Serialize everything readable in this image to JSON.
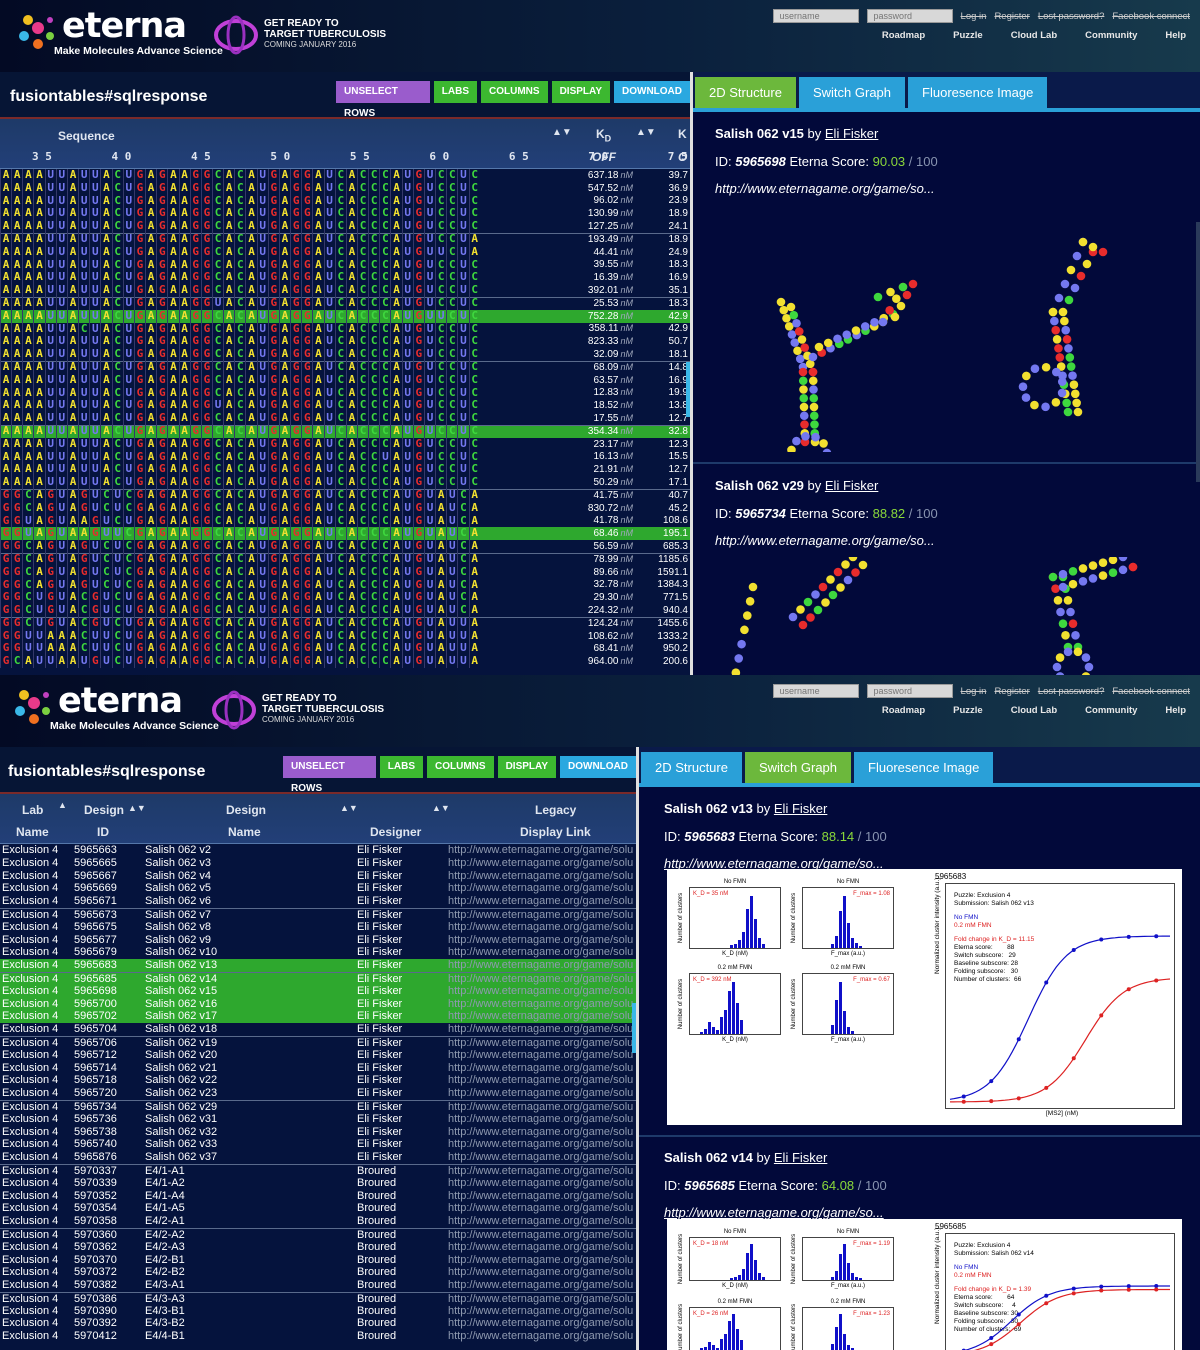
{
  "header": {
    "logo_text": "eterna",
    "tagline": "Make Molecules  Advance Science",
    "promo_line1": "GET READY TO",
    "promo_line2": "TARGET TUBERCULOSIS",
    "promo_line3": "COMING JANUARY 2016",
    "username_placeholder": "username",
    "password_placeholder": "password",
    "links": [
      "Log in",
      "Register",
      "Lost password?",
      "Facebook connect"
    ],
    "nav": [
      "Roadmap",
      "Puzzle",
      "Cloud Lab",
      "Community",
      "Help"
    ]
  },
  "toolbar": {
    "title": "fusiontables#sqlresponse",
    "buttons": [
      "UNSELECT ROWS",
      "LABS",
      "COLUMNS",
      "DISPLAY",
      "DOWNLOAD"
    ]
  },
  "tabs": [
    "2D Structure",
    "Switch Graph",
    "Fluoresence Image"
  ],
  "top_table": {
    "col_sequence": "Sequence",
    "col_kd": "K",
    "col_kd_sub": "D",
    "col_k_cut": "K",
    "ruler": "3 5         4 0         4 5         5 0         5 5         6 0         6 5         7 0         7 5",
    "off_label": "OFF",
    "on_label_cut": "O",
    "unit": "nM",
    "rows": [
      {
        "seq": "AAAAUUAUUACUGAGAAGGCACAUGAGGAUCACCCAUGUCCUC",
        "off": "637.18",
        "on": "39.7"
      },
      {
        "seq": "AAAAUUAUUACUGAGAAGGCACAUGAGGAUCACCCAUGUCCUC",
        "off": "547.52",
        "on": "36.9"
      },
      {
        "seq": "AAAAUUAUUACUGAGAAGGCACAUGAGGAUCACCCAUGUCCUC",
        "off": "96.02",
        "on": "23.9"
      },
      {
        "seq": "AAAAUUAUUACUGAGAAGGCACAUGAGGAUCACCCAUGUCCUC",
        "off": "130.99",
        "on": "18.9"
      },
      {
        "seq": "AAAAUUAUUACUGAGAAGGCACAUGAGGAUCACCCAUGUCCUC",
        "off": "127.25",
        "on": "24.1"
      },
      {
        "seq": "AAAAUUAUUACUGAGAAGGCACAUGAGGAUCACCCAUGUCCUA",
        "off": "193.49",
        "on": "18.9",
        "sep": true
      },
      {
        "seq": "AAAAUUAUUACUGAGAAGGCACAUGAGGAUCACCCAUGUUCUA",
        "off": "44.41",
        "on": "24.9"
      },
      {
        "seq": "AAAAUUAUUACUGAGAAGGCACAUGAGGAUCACCCAUGUCCUC",
        "off": "39.55",
        "on": "18.3"
      },
      {
        "seq": "AAAAUUAUUACUGAGAAGGCACAUGAGGAUCACCCAUGUCCUC",
        "off": "16.39",
        "on": "16.9"
      },
      {
        "seq": "AAAAUUAUUACUGAGAAGGCACAUGAGGAUCACCCAUGUCCUC",
        "off": "392.01",
        "on": "35.1"
      },
      {
        "seq": "AAAAUUAUUACUGAGAAGGUACAUGAGGAUCACCCAUGUCCUC",
        "off": "25.53",
        "on": "18.3",
        "sep": true
      },
      {
        "seq": "AAAAUUAUUACUGAGAAGGCACAUGAGGAUCACCCAUGUUCUC",
        "off": "752.28",
        "on": "42.9",
        "sel": true
      },
      {
        "seq": "AAAAUUACUACUGAGAAGGCACAUGAGGAUCACCCAUGUCCUC",
        "off": "358.11",
        "on": "42.9"
      },
      {
        "seq": "AAAAUUAUUACUGAGAAGGCACAUGAGGAUCACCCAUGUCCUC",
        "off": "823.33",
        "on": "50.7"
      },
      {
        "seq": "AAAAUUAUUACUGAGAAGGCACAUGAGGAUCACCCAUGUCCUC",
        "off": "32.09",
        "on": "18.1"
      },
      {
        "seq": "AAAAUUAUUACUGAGAAGGCACAUGAGGAUCACCCAUGUCCUC",
        "off": "68.09",
        "on": "14.8",
        "sep": true
      },
      {
        "seq": "AAAAUUAUUACUGAGAAGGCACAUGAGGAUCACCCAUGUCCUC",
        "off": "63.57",
        "on": "16.9"
      },
      {
        "seq": "AAAAUUAUUACUGAGAAGGCACAUGAGGAUCACCCAUGUCCUC",
        "off": "12.83",
        "on": "19.9"
      },
      {
        "seq": "AAAAUUAUUACUGAGAAGGUACAUGAGGAUCACCCAUGUCCUC",
        "off": "18.52",
        "on": "13.8"
      },
      {
        "seq": "AAAAUUAUUACUGAGAAGGCACAUGAGGAUCACCCAUGUCCUC",
        "off": "17.55",
        "on": "12.7"
      },
      {
        "seq": "AAAAUUAUUACUGAGAAGGCACAUGAGGAUCACCCAUGUCCUC",
        "off": "354.34",
        "on": "32.8",
        "sel": true,
        "sep": true
      },
      {
        "seq": "AAAAUUAUUACUGAGAAGGCACAUGAGGAUCACCCAUGUCCUC",
        "off": "23.17",
        "on": "12.3"
      },
      {
        "seq": "AAAAUUAUUACUGAGAAGGCACAUGAGGAUCACCUAUGUCCUC",
        "off": "16.13",
        "on": "15.5"
      },
      {
        "seq": "AAAAUUAUUACUGAGAAGGCACAUGAGGAUCACCCAUGUCCUC",
        "off": "21.91",
        "on": "12.7"
      },
      {
        "seq": "AAAAUUAUUACUGAGAAGGCACAUGAGGAUCACCCAUGUCCUC",
        "off": "50.29",
        "on": "17.1"
      },
      {
        "seq": "GGCAGUAGUCUCGAGAAGGCACAUGAGGAUCACCCAUGUAUCA",
        "off": "41.75",
        "on": "40.7",
        "sep": true
      },
      {
        "seq": "GGCAGUAGUCUCGAGAAGGCACAUGAGGAUCACCCAUGUAUCA",
        "off": "830.72",
        "on": "45.2"
      },
      {
        "seq": "GGUAGUAAGUCUGAGAAGGCACAUGAGGAUCACCCAUGUAUCA",
        "off": "41.78",
        "on": "108.6"
      },
      {
        "seq": "GGUAGUAAGUUCGAGAAGGCACAUGAGGAUCACCCAUGUAUCA",
        "off": "68.46",
        "on": "195.1",
        "sel": true
      },
      {
        "seq": "GGCAGUAGUCUCGAGAAGGCACAUGAGGAUCACCCAUGUAUCA",
        "off": "56.59",
        "on": "685.3"
      },
      {
        "seq": "GGCAGUAGUCUCGAGAAGGCACAUGAGGAUCACCCAUGUAUCA",
        "off": "78.99",
        "on": "1185.6",
        "sep": true
      },
      {
        "seq": "GGCAGUAGUCUCGAGAAGGCACAUGAGGAUCACCCAUGUAUCA",
        "off": "89.66",
        "on": "1591.1"
      },
      {
        "seq": "GGCAGUAGUCUCGAGAAGGCACAUGAGGAUCACCCAUGUAUCA",
        "off": "32.78",
        "on": "1384.3"
      },
      {
        "seq": "GGCUGUACGUCUGAGAAGGCACAUGAGGAUCACCCAUGUAUCA",
        "off": "29.30",
        "on": "771.5"
      },
      {
        "seq": "GGCUGUACGUCUGAGAAGGCACAUGAGGAUCACCCAUGUAUCA",
        "off": "224.32",
        "on": "940.4"
      },
      {
        "seq": "GGCUGUACGUCUGAGAAGGCACAUGAGGAUCACCCAUGUAUUA",
        "off": "124.24",
        "on": "1455.6",
        "sep": true
      },
      {
        "seq": "GGUUAAACUUCUGAGAAGGCACAUGAGGAUCACCCAUGUAUUA",
        "off": "108.62",
        "on": "1333.2"
      },
      {
        "seq": "GGUUAAACUUCUGAGAAGGCACAUGAGGAUCACCCAUGUAUUA",
        "off": "68.41",
        "on": "950.2"
      },
      {
        "seq": "GCAUUAAUGUCUGAGAAGGCACAUGAGGAUCACCCAUGUAUUA",
        "off": "964.00",
        "on": "200.6"
      }
    ]
  },
  "top_cards": [
    {
      "title": "Salish 062 v15",
      "by": "by",
      "author": "Eli Fisker",
      "id_label": "ID:",
      "id": "5965698",
      "score_label": "Eterna Score:",
      "score": "90.03",
      "out_of": "/ 100",
      "link": "http://www.eternagame.org/game/so..."
    },
    {
      "title": "Salish 062 v29",
      "by": "by",
      "author": "Eli Fisker",
      "id_label": "ID:",
      "id": "5965734",
      "score_label": "Eterna Score:",
      "score": "88.82",
      "out_of": "/ 100",
      "link": "http://www.eternagame.org/game/so..."
    }
  ],
  "bottom_table": {
    "headers": {
      "lab": "Lab",
      "design1": "Design",
      "design2": "Design",
      "legacy": "Legacy",
      "name": "Name",
      "id": "ID",
      "dname": "Name",
      "designer": "Designer",
      "link": "Display Link"
    },
    "rows": [
      {
        "lab": "Exclusion 4",
        "id": "5965663",
        "name": "Salish 062 v2",
        "designer": "Eli Fisker"
      },
      {
        "lab": "Exclusion 4",
        "id": "5965665",
        "name": "Salish 062 v3",
        "designer": "Eli Fisker"
      },
      {
        "lab": "Exclusion 4",
        "id": "5965667",
        "name": "Salish 062 v4",
        "designer": "Eli Fisker"
      },
      {
        "lab": "Exclusion 4",
        "id": "5965669",
        "name": "Salish 062 v5",
        "designer": "Eli Fisker"
      },
      {
        "lab": "Exclusion 4",
        "id": "5965671",
        "name": "Salish 062 v6",
        "designer": "Eli Fisker"
      },
      {
        "lab": "Exclusion 4",
        "id": "5965673",
        "name": "Salish 062 v7",
        "designer": "Eli Fisker",
        "sep": true
      },
      {
        "lab": "Exclusion 4",
        "id": "5965675",
        "name": "Salish 062 v8",
        "designer": "Eli Fisker"
      },
      {
        "lab": "Exclusion 4",
        "id": "5965677",
        "name": "Salish 062 v9",
        "designer": "Eli Fisker"
      },
      {
        "lab": "Exclusion 4",
        "id": "5965679",
        "name": "Salish 062 v10",
        "designer": "Eli Fisker"
      },
      {
        "lab": "Exclusion 4",
        "id": "5965683",
        "name": "Salish 062 v13",
        "designer": "Eli Fisker",
        "sel": true
      },
      {
        "lab": "Exclusion 4",
        "id": "5965685",
        "name": "Salish 062 v14",
        "designer": "Eli Fisker",
        "sel": true,
        "sep": true
      },
      {
        "lab": "Exclusion 4",
        "id": "5965698",
        "name": "Salish 062 v15",
        "designer": "Eli Fisker",
        "sel": true
      },
      {
        "lab": "Exclusion 4",
        "id": "5965700",
        "name": "Salish 062 v16",
        "designer": "Eli Fisker",
        "sel": true
      },
      {
        "lab": "Exclusion 4",
        "id": "5965702",
        "name": "Salish 062 v17",
        "designer": "Eli Fisker",
        "sel": true
      },
      {
        "lab": "Exclusion 4",
        "id": "5965704",
        "name": "Salish 062 v18",
        "designer": "Eli Fisker"
      },
      {
        "lab": "Exclusion 4",
        "id": "5965706",
        "name": "Salish 062 v19",
        "designer": "Eli Fisker",
        "sep": true
      },
      {
        "lab": "Exclusion 4",
        "id": "5965712",
        "name": "Salish 062 v20",
        "designer": "Eli Fisker"
      },
      {
        "lab": "Exclusion 4",
        "id": "5965714",
        "name": "Salish 062 v21",
        "designer": "Eli Fisker"
      },
      {
        "lab": "Exclusion 4",
        "id": "5965718",
        "name": "Salish 062 v22",
        "designer": "Eli Fisker"
      },
      {
        "lab": "Exclusion 4",
        "id": "5965720",
        "name": "Salish 062 v23",
        "designer": "Eli Fisker"
      },
      {
        "lab": "Exclusion 4",
        "id": "5965734",
        "name": "Salish 062 v29",
        "designer": "Eli Fisker",
        "sep": true
      },
      {
        "lab": "Exclusion 4",
        "id": "5965736",
        "name": "Salish 062 v31",
        "designer": "Eli Fisker"
      },
      {
        "lab": "Exclusion 4",
        "id": "5965738",
        "name": "Salish 062 v32",
        "designer": "Eli Fisker"
      },
      {
        "lab": "Exclusion 4",
        "id": "5965740",
        "name": "Salish 062 v33",
        "designer": "Eli Fisker"
      },
      {
        "lab": "Exclusion 4",
        "id": "5965876",
        "name": "Salish 062 v37",
        "designer": "Eli Fisker"
      },
      {
        "lab": "Exclusion 4",
        "id": "5970337",
        "name": "E4/1-A1",
        "designer": "Broured",
        "sep": true
      },
      {
        "lab": "Exclusion 4",
        "id": "5970339",
        "name": "E4/1-A2",
        "designer": "Broured"
      },
      {
        "lab": "Exclusion 4",
        "id": "5970352",
        "name": "E4/1-A4",
        "designer": "Broured"
      },
      {
        "lab": "Exclusion 4",
        "id": "5970354",
        "name": "E4/1-A5",
        "designer": "Broured"
      },
      {
        "lab": "Exclusion 4",
        "id": "5970358",
        "name": "E4/2-A1",
        "designer": "Broured"
      },
      {
        "lab": "Exclusion 4",
        "id": "5970360",
        "name": "E4/2-A2",
        "designer": "Broured",
        "sep": true
      },
      {
        "lab": "Exclusion 4",
        "id": "5970362",
        "name": "E4/2-A3",
        "designer": "Broured"
      },
      {
        "lab": "Exclusion 4",
        "id": "5970370",
        "name": "E4/2-B1",
        "designer": "Broured"
      },
      {
        "lab": "Exclusion 4",
        "id": "5970372",
        "name": "E4/2-B2",
        "designer": "Broured"
      },
      {
        "lab": "Exclusion 4",
        "id": "5970382",
        "name": "E4/3-A1",
        "designer": "Broured"
      },
      {
        "lab": "Exclusion 4",
        "id": "5970386",
        "name": "E4/3-A3",
        "designer": "Broured",
        "sep": true
      },
      {
        "lab": "Exclusion 4",
        "id": "5970390",
        "name": "E4/3-B1",
        "designer": "Broured"
      },
      {
        "lab": "Exclusion 4",
        "id": "5970392",
        "name": "E4/3-B2",
        "designer": "Broured"
      },
      {
        "lab": "Exclusion 4",
        "id": "5970412",
        "name": "E4/4-B1",
        "designer": "Broured"
      }
    ],
    "link_text": "http://www.eternagame.org/game/solu"
  },
  "bottom_cards": [
    {
      "title": "Salish 062 v13",
      "by": "by",
      "author": "Eli Fisker",
      "id_label": "ID:",
      "id": "5965683",
      "score_label": "Eterna Score:",
      "score": "88.14",
      "out_of": "/ 100",
      "link": "http://www.eternagame.org/game/so...",
      "graph": {
        "gid": "5965683",
        "p1_title": "No FMN",
        "p1_val": "K_D = 35 nM",
        "p2_title": "No FMN",
        "p2_val": "F_max = 1.08",
        "p3_title": "0.2 mM FMN",
        "p3_val": "K_D = 392 nM",
        "p4_title": "0.2 mM FMN",
        "p4_val": "F_max = 0.67",
        "legend": [
          "Puzzle: Exclusion 4",
          "Submission: Salish 062 v13",
          "",
          "No FMN",
          "0.2 mM FMN",
          "",
          "Fold change in K_D = 11.15",
          "Eterna score:        88",
          "Switch subscore:   29",
          "Baseline subscore: 28",
          "Folding subscore:   30",
          "Number of clusters:  66"
        ]
      }
    },
    {
      "title": "Salish 062 v14",
      "by": "by",
      "author": "Eli Fisker",
      "id_label": "ID:",
      "id": "5965685",
      "score_label": "Eterna Score:",
      "score": "64.08",
      "out_of": "/ 100",
      "link": "http://www.eternagame.org/game/so...",
      "graph": {
        "gid": "5965685",
        "p1_title": "No FMN",
        "p1_val": "K_D = 18 nM",
        "p2_title": "No FMN",
        "p2_val": "F_max = 1.19",
        "p3_title": "0.2 mM FMN",
        "p3_val": "K_D = 26 nM",
        "p4_title": "0.2 mM FMN",
        "p4_val": "F_max = 1.23",
        "legend": [
          "Puzzle: Exclusion 4",
          "Submission: Salish 062 v14",
          "",
          "No FMN",
          "0.2 mM FMN",
          "",
          "Fold change in K_D = 1.39",
          "Eterna score:        64",
          "Switch subscore:     4",
          "Baseline subscore: 30",
          "Folding subscore:   30",
          "Number of clusters:  69"
        ]
      }
    }
  ],
  "graph_axes": {
    "hist_ylabel": "Number of clusters",
    "hist_xlabel_kd": "K_D (nM)",
    "hist_xlabel_f": "F_max (a.u.)",
    "curve_ylabel": "Normalized cluster intensity (a.u.)",
    "curve_xlabel": "[MS2] (nM)"
  },
  "colors": {
    "nt_A": "#f2e030",
    "nt_U": "#7478f0",
    "nt_G": "#e82c2c",
    "nt_C": "#3ed83e",
    "selected_row": "#2ea82e"
  }
}
